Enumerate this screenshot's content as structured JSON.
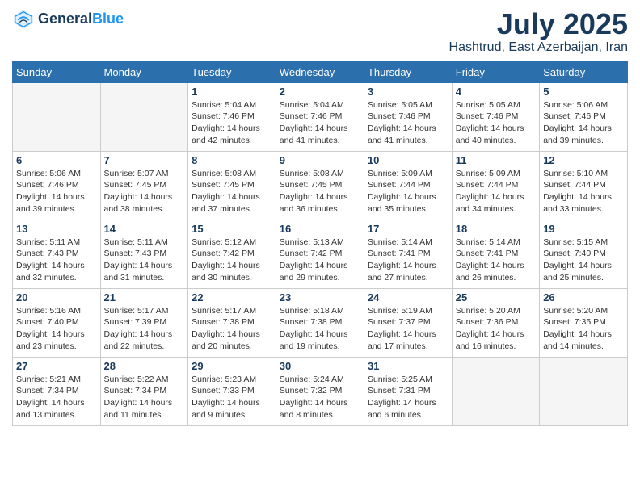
{
  "logo": {
    "line1": "General",
    "line2": "Blue"
  },
  "title": "July 2025",
  "location": "Hashtrud, East Azerbaijan, Iran",
  "days_of_week": [
    "Sunday",
    "Monday",
    "Tuesday",
    "Wednesday",
    "Thursday",
    "Friday",
    "Saturday"
  ],
  "weeks": [
    [
      {
        "day": "",
        "info": ""
      },
      {
        "day": "",
        "info": ""
      },
      {
        "day": "1",
        "info": "Sunrise: 5:04 AM\nSunset: 7:46 PM\nDaylight: 14 hours\nand 42 minutes."
      },
      {
        "day": "2",
        "info": "Sunrise: 5:04 AM\nSunset: 7:46 PM\nDaylight: 14 hours\nand 41 minutes."
      },
      {
        "day": "3",
        "info": "Sunrise: 5:05 AM\nSunset: 7:46 PM\nDaylight: 14 hours\nand 41 minutes."
      },
      {
        "day": "4",
        "info": "Sunrise: 5:05 AM\nSunset: 7:46 PM\nDaylight: 14 hours\nand 40 minutes."
      },
      {
        "day": "5",
        "info": "Sunrise: 5:06 AM\nSunset: 7:46 PM\nDaylight: 14 hours\nand 39 minutes."
      }
    ],
    [
      {
        "day": "6",
        "info": "Sunrise: 5:06 AM\nSunset: 7:46 PM\nDaylight: 14 hours\nand 39 minutes."
      },
      {
        "day": "7",
        "info": "Sunrise: 5:07 AM\nSunset: 7:45 PM\nDaylight: 14 hours\nand 38 minutes."
      },
      {
        "day": "8",
        "info": "Sunrise: 5:08 AM\nSunset: 7:45 PM\nDaylight: 14 hours\nand 37 minutes."
      },
      {
        "day": "9",
        "info": "Sunrise: 5:08 AM\nSunset: 7:45 PM\nDaylight: 14 hours\nand 36 minutes."
      },
      {
        "day": "10",
        "info": "Sunrise: 5:09 AM\nSunset: 7:44 PM\nDaylight: 14 hours\nand 35 minutes."
      },
      {
        "day": "11",
        "info": "Sunrise: 5:09 AM\nSunset: 7:44 PM\nDaylight: 14 hours\nand 34 minutes."
      },
      {
        "day": "12",
        "info": "Sunrise: 5:10 AM\nSunset: 7:44 PM\nDaylight: 14 hours\nand 33 minutes."
      }
    ],
    [
      {
        "day": "13",
        "info": "Sunrise: 5:11 AM\nSunset: 7:43 PM\nDaylight: 14 hours\nand 32 minutes."
      },
      {
        "day": "14",
        "info": "Sunrise: 5:11 AM\nSunset: 7:43 PM\nDaylight: 14 hours\nand 31 minutes."
      },
      {
        "day": "15",
        "info": "Sunrise: 5:12 AM\nSunset: 7:42 PM\nDaylight: 14 hours\nand 30 minutes."
      },
      {
        "day": "16",
        "info": "Sunrise: 5:13 AM\nSunset: 7:42 PM\nDaylight: 14 hours\nand 29 minutes."
      },
      {
        "day": "17",
        "info": "Sunrise: 5:14 AM\nSunset: 7:41 PM\nDaylight: 14 hours\nand 27 minutes."
      },
      {
        "day": "18",
        "info": "Sunrise: 5:14 AM\nSunset: 7:41 PM\nDaylight: 14 hours\nand 26 minutes."
      },
      {
        "day": "19",
        "info": "Sunrise: 5:15 AM\nSunset: 7:40 PM\nDaylight: 14 hours\nand 25 minutes."
      }
    ],
    [
      {
        "day": "20",
        "info": "Sunrise: 5:16 AM\nSunset: 7:40 PM\nDaylight: 14 hours\nand 23 minutes."
      },
      {
        "day": "21",
        "info": "Sunrise: 5:17 AM\nSunset: 7:39 PM\nDaylight: 14 hours\nand 22 minutes."
      },
      {
        "day": "22",
        "info": "Sunrise: 5:17 AM\nSunset: 7:38 PM\nDaylight: 14 hours\nand 20 minutes."
      },
      {
        "day": "23",
        "info": "Sunrise: 5:18 AM\nSunset: 7:38 PM\nDaylight: 14 hours\nand 19 minutes."
      },
      {
        "day": "24",
        "info": "Sunrise: 5:19 AM\nSunset: 7:37 PM\nDaylight: 14 hours\nand 17 minutes."
      },
      {
        "day": "25",
        "info": "Sunrise: 5:20 AM\nSunset: 7:36 PM\nDaylight: 14 hours\nand 16 minutes."
      },
      {
        "day": "26",
        "info": "Sunrise: 5:20 AM\nSunset: 7:35 PM\nDaylight: 14 hours\nand 14 minutes."
      }
    ],
    [
      {
        "day": "27",
        "info": "Sunrise: 5:21 AM\nSunset: 7:34 PM\nDaylight: 14 hours\nand 13 minutes."
      },
      {
        "day": "28",
        "info": "Sunrise: 5:22 AM\nSunset: 7:34 PM\nDaylight: 14 hours\nand 11 minutes."
      },
      {
        "day": "29",
        "info": "Sunrise: 5:23 AM\nSunset: 7:33 PM\nDaylight: 14 hours\nand 9 minutes."
      },
      {
        "day": "30",
        "info": "Sunrise: 5:24 AM\nSunset: 7:32 PM\nDaylight: 14 hours\nand 8 minutes."
      },
      {
        "day": "31",
        "info": "Sunrise: 5:25 AM\nSunset: 7:31 PM\nDaylight: 14 hours\nand 6 minutes."
      },
      {
        "day": "",
        "info": ""
      },
      {
        "day": "",
        "info": ""
      }
    ]
  ]
}
